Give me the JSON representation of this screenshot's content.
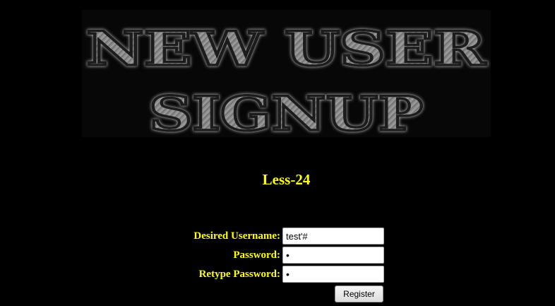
{
  "banner": {
    "line1": "NEW USER",
    "line2": "SIGNUP"
  },
  "page": {
    "title": "Less-24"
  },
  "form": {
    "username_label": "Desired Username:",
    "username_value": "test'#",
    "password_label": "Password:",
    "password_value": "1",
    "retype_label": "Retype Password:",
    "retype_value": "1",
    "submit_label": "Register"
  },
  "colors": {
    "background": "#000000",
    "label_text": "#ffff00",
    "banner_text": "#8a8a8a"
  }
}
